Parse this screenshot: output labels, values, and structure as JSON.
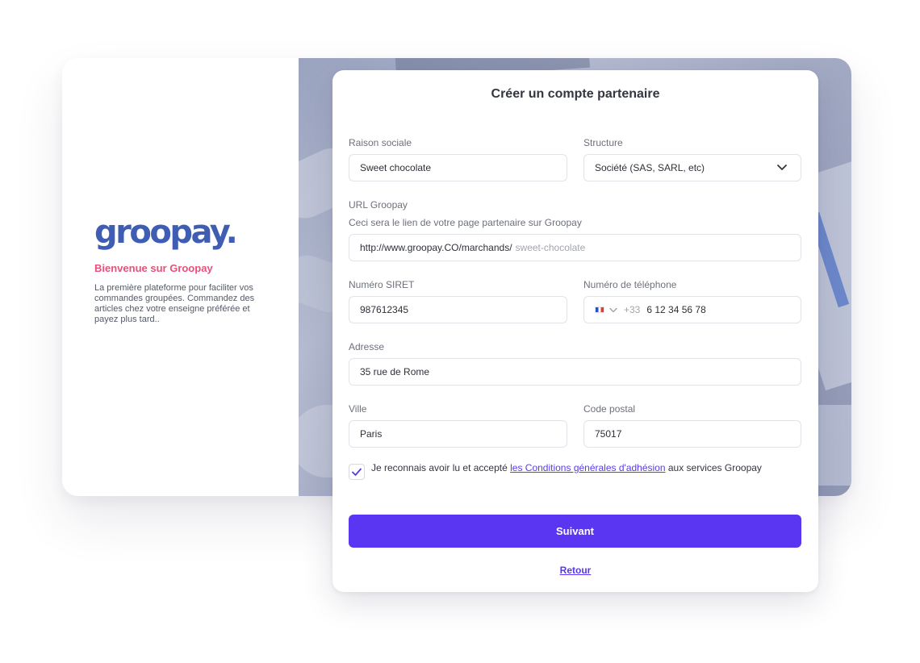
{
  "colors": {
    "brand_blue": "#3f5eb3",
    "brand_pink": "#ea4f7a",
    "primary_button": "#5b36f2",
    "link": "#5b3ae8"
  },
  "left_panel": {
    "logo": "groopay.",
    "welcome": "Bienvenue sur Groopay",
    "intro": "La première plateforme pour faciliter vos commandes groupées. Commandez des articles chez votre enseigne préférée et payez plus tard.."
  },
  "form": {
    "title": "Créer un compte partenaire",
    "raison_sociale": {
      "label": "Raison sociale",
      "value": "Sweet chocolate"
    },
    "structure": {
      "label": "Structure",
      "value": "Société (SAS, SARL, etc)",
      "icon": "chevron-down-icon"
    },
    "url": {
      "label": "URL Groopay",
      "hint": "Ceci sera le lien de votre page partenaire sur Groopay",
      "prefix": "http://www.groopay.CO/marchands/",
      "slug": "sweet-chocolate"
    },
    "siret": {
      "label": "Numéro SIRET",
      "value": "987612345"
    },
    "phone": {
      "label": "Numéro de téléphone",
      "country_icon": "france-flag-icon",
      "country_code": "+33",
      "value": "6 12 34 56 78"
    },
    "adresse": {
      "label": "Adresse",
      "value": "35 rue de Rome"
    },
    "ville": {
      "label": "Ville",
      "value": "Paris"
    },
    "code_postal": {
      "label": "Code postal",
      "value": "75017"
    },
    "terms": {
      "checked": true,
      "before": "Je reconnais avoir lu et accepté ",
      "link": "les Conditions générales d'adhésion",
      "after": " aux services Groopay"
    },
    "submit_label": "Suivant",
    "back_label": "Retour"
  }
}
